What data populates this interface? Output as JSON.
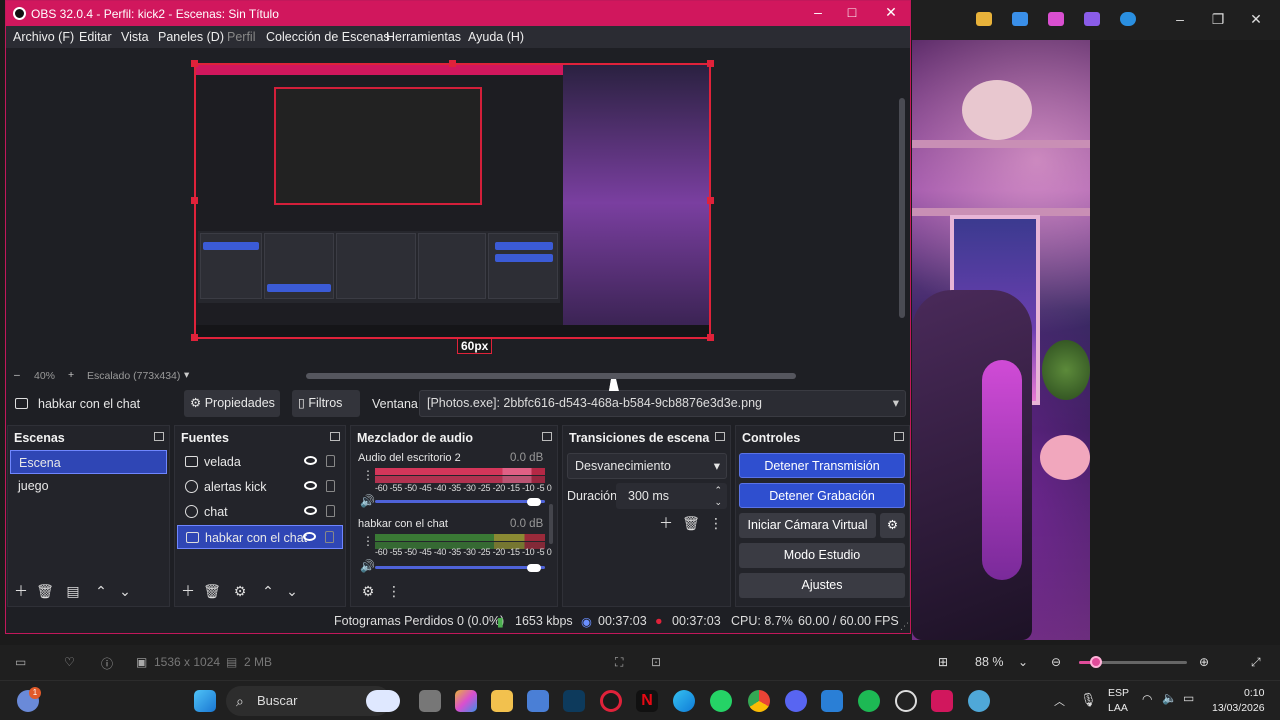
{
  "obs": {
    "title": "OBS 32.0.4 - Perfil: kick2 - Escenas: Sin Título",
    "menu": [
      "Archivo (F)",
      "Editar",
      "Vista",
      "Paneles (D)",
      "Perfil",
      "Colección de Escenas",
      "Herramientas",
      "Ayuda (H)"
    ],
    "preview": {
      "zoom": "40%",
      "scaling": "Escalado (773x434)",
      "fps_overlay": "60px"
    },
    "source_toolbar": {
      "selected_source": "habkar con el chat",
      "properties_label": "Propiedades",
      "filters_label": "Filtros",
      "window_label": "Ventana",
      "window_value": "[Photos.exe]: 2bbfc616-d543-468a-b584-9cb8876e3d3e.png"
    },
    "scenes": {
      "title": "Escenas",
      "items": [
        "Escena",
        "juego"
      ]
    },
    "sources": {
      "title": "Fuentes",
      "items": [
        "velada",
        "alertas kick",
        "chat",
        "habkar con el chat"
      ]
    },
    "mixer": {
      "title": "Mezclador de audio",
      "channels": [
        {
          "name": "Audio del escritorio 2",
          "db": "0.0 dB"
        },
        {
          "name": "habkar con el chat",
          "db": "0.0 dB"
        }
      ],
      "scale": "-60 -55 -50 -45 -40 -35 -30 -25 -20 -15 -10  -5   0"
    },
    "transitions": {
      "title": "Transiciones de escena",
      "selected": "Desvanecimiento",
      "duration_label": "Duración",
      "duration_value": "300 ms"
    },
    "controls": {
      "title": "Controles",
      "stop_stream": "Detener Transmisión",
      "stop_record": "Detener Grabación",
      "virtual_cam": "Iniciar Cámara Virtual",
      "studio_mode": "Modo Estudio",
      "settings": "Ajustes"
    },
    "status": {
      "dropped_frames": "Fotogramas Perdidos 0 (0.0%)",
      "bitrate": "1653 kbps",
      "stream_time": "00:37:03",
      "record_time": "00:37:03",
      "cpu": "CPU: 8.7%",
      "fps": "60.00 / 60.00 FPS"
    }
  },
  "photos": {
    "dimensions": "1536 x 1024",
    "size": "2 MB",
    "zoom": "88 %"
  },
  "taskbar": {
    "search_placeholder": "Buscar",
    "lang_top": "ESP",
    "lang_bottom": "LAA",
    "time": "0:10",
    "date": "13/03/2026",
    "weather_badge": "1"
  },
  "colors": {
    "obs_title": "#d1175d",
    "selection_blue": "#2f46b5",
    "button_blue": "#2f4fcf",
    "canvas_border": "#e0223a"
  }
}
